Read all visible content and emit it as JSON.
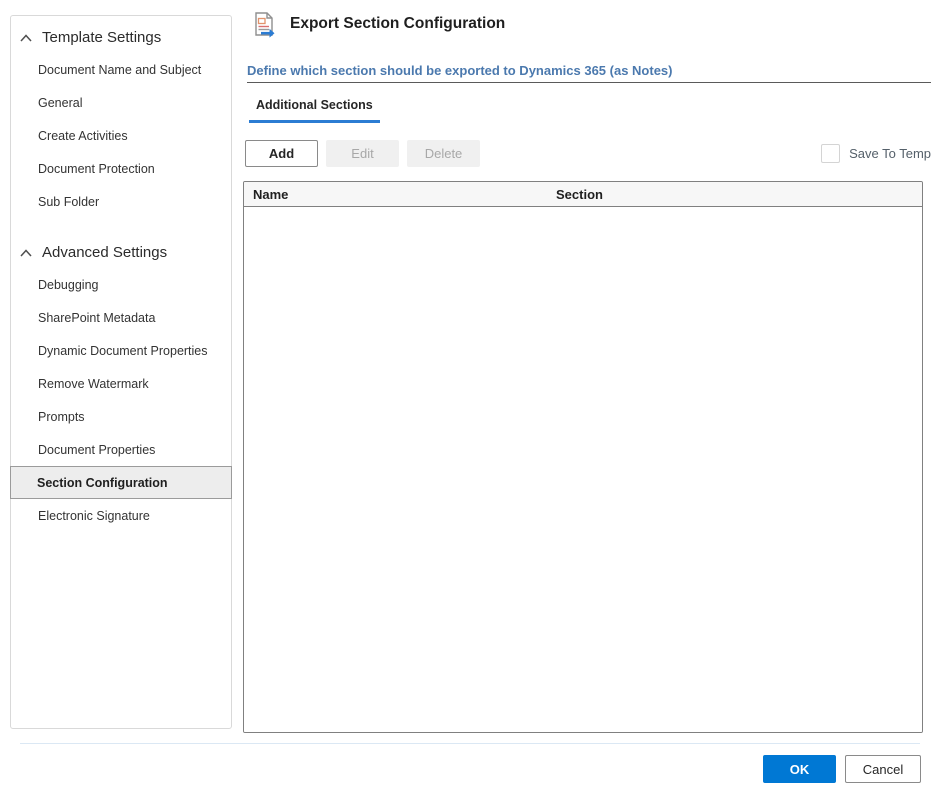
{
  "sidebar": {
    "sections": [
      {
        "title": "Template Settings",
        "collapse_icon": "chevron-up-icon",
        "items": [
          {
            "label": "Document Name and Subject",
            "selected": false
          },
          {
            "label": "General",
            "selected": false
          },
          {
            "label": "Create Activities",
            "selected": false
          },
          {
            "label": "Document Protection",
            "selected": false
          },
          {
            "label": "Sub Folder",
            "selected": false
          }
        ]
      },
      {
        "title": "Advanced Settings",
        "collapse_icon": "chevron-up-icon",
        "items": [
          {
            "label": "Debugging",
            "selected": false
          },
          {
            "label": "SharePoint Metadata",
            "selected": false
          },
          {
            "label": "Dynamic Document Properties",
            "selected": false
          },
          {
            "label": "Remove Watermark",
            "selected": false
          },
          {
            "label": "Prompts",
            "selected": false
          },
          {
            "label": "Document Properties",
            "selected": false
          },
          {
            "label": "Section Configuration",
            "selected": true
          },
          {
            "label": "Electronic Signature",
            "selected": false
          }
        ]
      }
    ]
  },
  "main": {
    "icon": "export-document-icon",
    "title": "Export Section Configuration",
    "description": "Define which section should be exported to Dynamics 365 (as Notes)",
    "tabs": [
      {
        "label": "Additional Sections",
        "active": true
      }
    ],
    "toolbar": {
      "add_label": "Add",
      "edit_label": "Edit",
      "edit_enabled": false,
      "delete_label": "Delete",
      "delete_enabled": false,
      "save_to_temp_label": "Save To Temp",
      "save_to_temp_checked": false
    },
    "table": {
      "columns": [
        "Name",
        "Section"
      ],
      "rows": []
    }
  },
  "footer": {
    "ok_label": "OK",
    "cancel_label": "Cancel"
  },
  "colors": {
    "accent_blue": "#0078d4",
    "tab_underline_blue": "#2b7cd3",
    "link_blue": "#4b79ae",
    "selected_item_bg": "#ededed",
    "disabled_bg": "#f0f0f0",
    "disabled_text": "#a8a8a8",
    "grid_border": "#808080"
  }
}
